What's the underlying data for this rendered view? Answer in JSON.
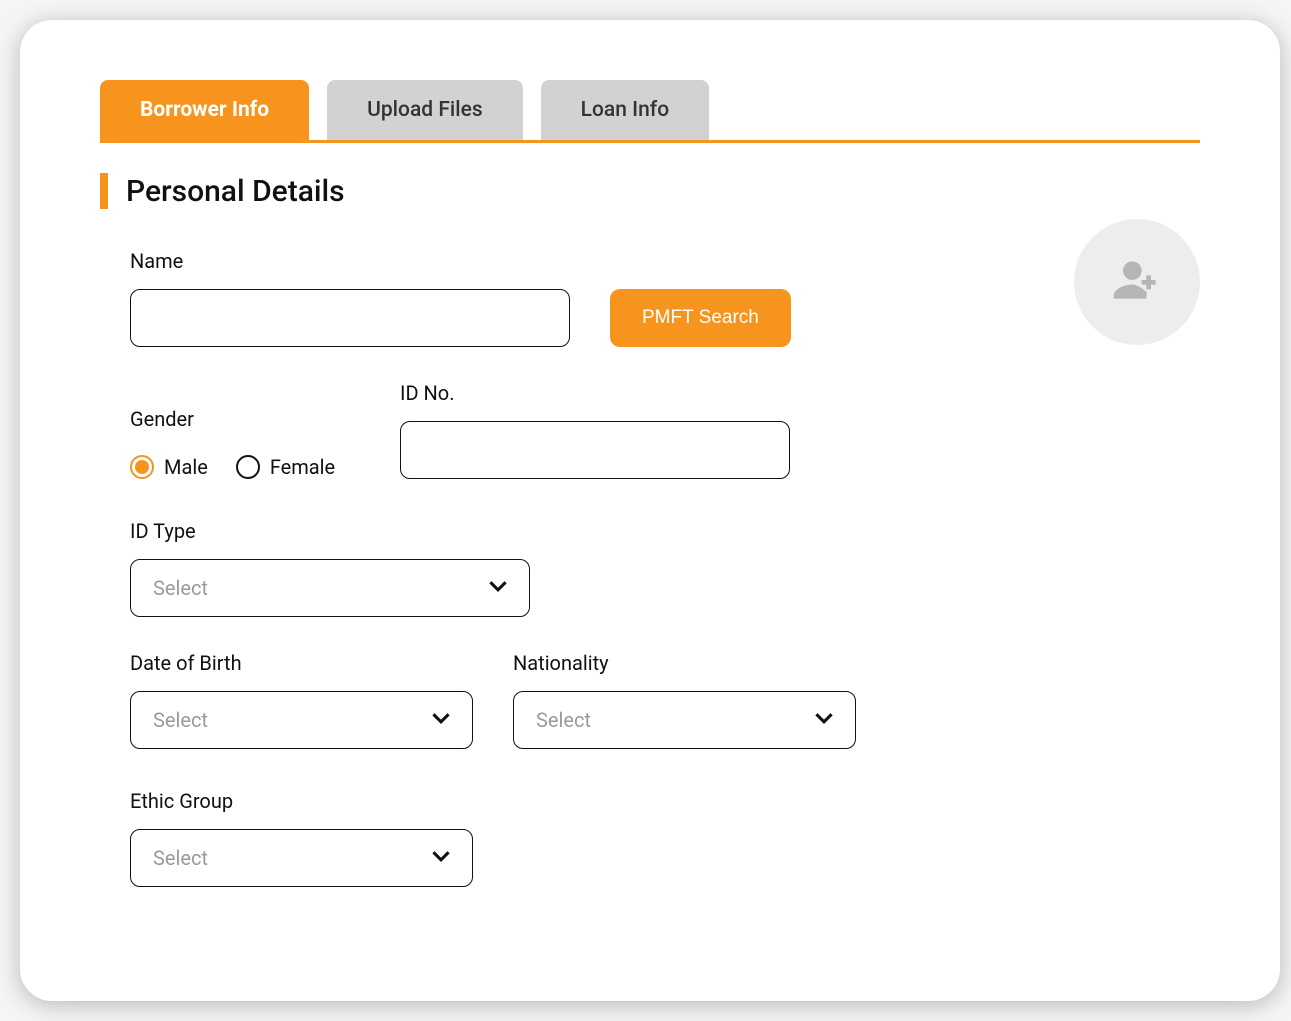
{
  "tabs": [
    {
      "label": "Borrower Info",
      "active": true
    },
    {
      "label": "Upload Files",
      "active": false
    },
    {
      "label": "Loan Info",
      "active": false
    }
  ],
  "section_title": "Personal Details",
  "name": {
    "label": "Name",
    "value": "",
    "search_button": "PMFT Search"
  },
  "gender": {
    "label": "Gender",
    "options": [
      {
        "label": "Male",
        "checked": true
      },
      {
        "label": "Female",
        "checked": false
      }
    ]
  },
  "id_no": {
    "label": "ID No.",
    "value": ""
  },
  "id_type": {
    "label": "ID Type",
    "placeholder": "Select"
  },
  "dob": {
    "label": "Date of Birth",
    "placeholder": "Select"
  },
  "nationality": {
    "label": "Nationality",
    "placeholder": "Select"
  },
  "ethic_group": {
    "label": "Ethic Group",
    "placeholder": "Select"
  }
}
